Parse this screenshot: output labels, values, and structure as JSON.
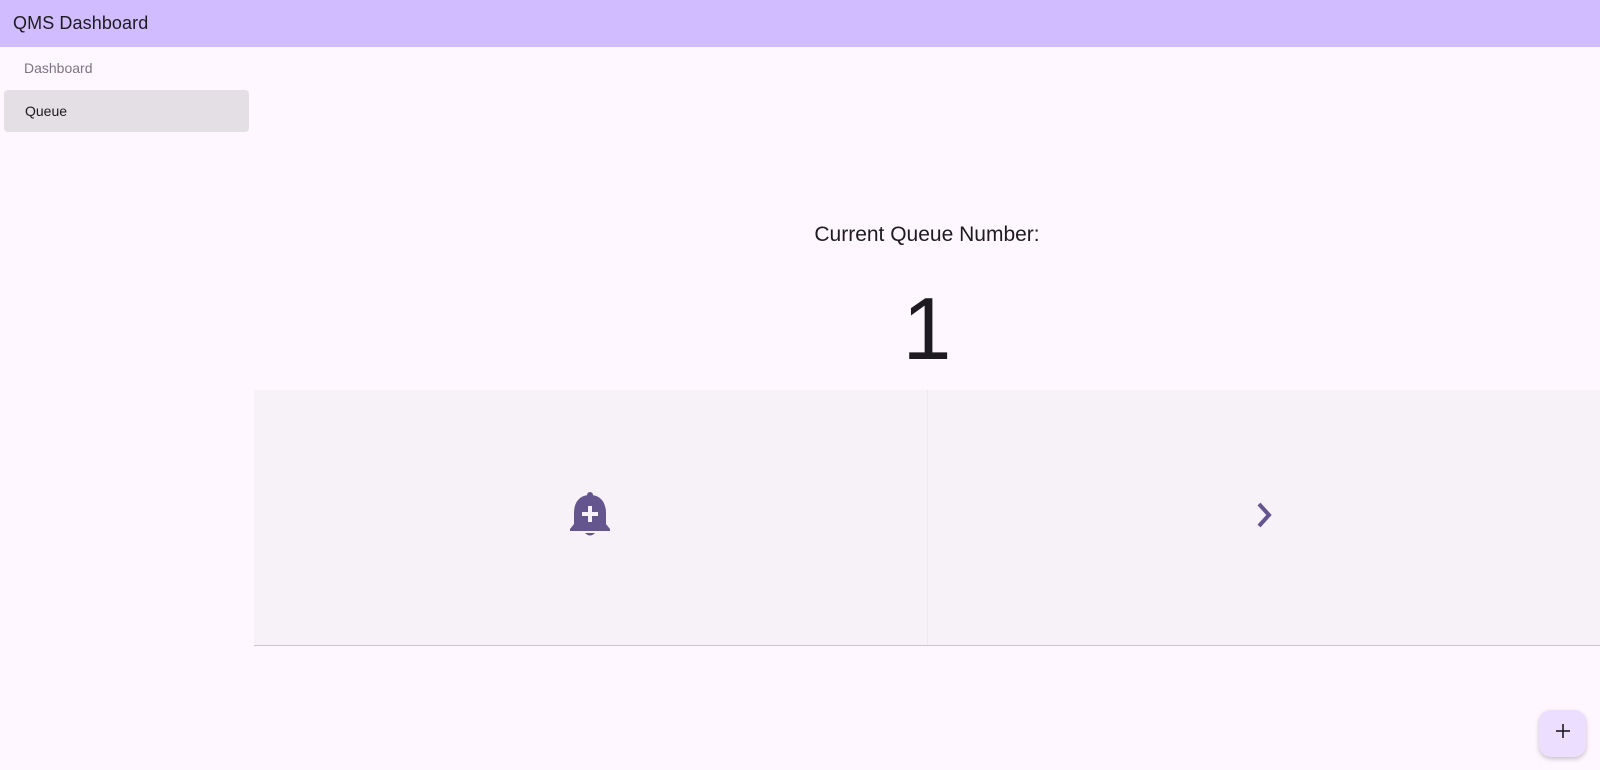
{
  "app_bar": {
    "title": "QMS Dashboard"
  },
  "sidebar": {
    "section_label": "Dashboard",
    "items": [
      {
        "label": "Queue",
        "selected": true
      }
    ]
  },
  "main": {
    "heading": "Current Queue Number:",
    "queue_number": "1",
    "actions": [
      {
        "icon": "notification-add-icon",
        "color": "#65558f"
      },
      {
        "icon": "chevron-right-icon",
        "color": "#65558f"
      }
    ]
  },
  "fab": {
    "icon": "plus-icon"
  },
  "colors": {
    "app_bar": "#d0bcff",
    "background": "#fef7ff",
    "nav_selected": "#e3dfe4",
    "panel": "#f6f2f8",
    "accent": "#65558f",
    "fab": "#ebdeff"
  }
}
